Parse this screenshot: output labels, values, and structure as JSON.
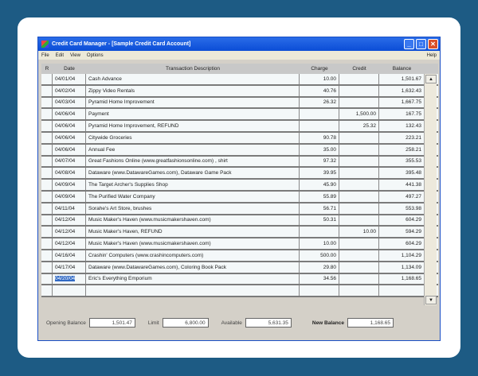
{
  "window": {
    "title": "Credit Card Manager - [Sample Credit Card Account]"
  },
  "menu": {
    "file": "File",
    "edit": "Edit",
    "view": "View",
    "options": "Options",
    "help": "Help"
  },
  "columns": {
    "r": "R",
    "date": "Date",
    "desc": "Transaction Description",
    "charge": "Charge",
    "credit": "Credit",
    "balance": "Balance"
  },
  "rows": [
    {
      "date": "04/01/04",
      "desc": "Cash Advance",
      "charge": "10.00",
      "credit": "",
      "balance": "1,501.67"
    },
    {
      "date": "04/02/04",
      "desc": "Zippy Video Rentals",
      "charge": "40.76",
      "credit": "",
      "balance": "1,632.43"
    },
    {
      "date": "04/03/04",
      "desc": "Pyramid Home Improvement",
      "charge": "26.32",
      "credit": "",
      "balance": "1,667.75"
    },
    {
      "date": "04/06/04",
      "desc": "Payment",
      "charge": "",
      "credit": "1,500.00",
      "balance": "167.75"
    },
    {
      "date": "04/06/04",
      "desc": "Pyramid Home Improvement, REFUND",
      "charge": "",
      "credit": "25.32",
      "balance": "132.43"
    },
    {
      "date": "04/06/04",
      "desc": "Citywide Groceries",
      "charge": "90.78",
      "credit": "",
      "balance": "223.21"
    },
    {
      "date": "04/06/04",
      "desc": "Annual Fee",
      "charge": "35.00",
      "credit": "",
      "balance": "258.21"
    },
    {
      "date": "04/07/04",
      "desc": "Great Fashions Online (www.greatfashionsonline.com) , shirt",
      "charge": "97.32",
      "credit": "",
      "balance": "355.53"
    },
    {
      "date": "04/08/04",
      "desc": "Dataware (www.DatawareGames.com), Dataware Game Pack",
      "charge": "39.95",
      "credit": "",
      "balance": "395.48"
    },
    {
      "date": "04/09/04",
      "desc": "The Target Archer's Supplies Shop",
      "charge": "45.90",
      "credit": "",
      "balance": "441.38"
    },
    {
      "date": "04/09/04",
      "desc": "The Purified Water Company",
      "charge": "55.89",
      "credit": "",
      "balance": "497.27"
    },
    {
      "date": "04/11/04",
      "desc": "Sorahe's Art Store, brushes",
      "charge": "56.71",
      "credit": "",
      "balance": "553.98"
    },
    {
      "date": "04/12/04",
      "desc": "Music Maker's Haven (www.musicmakershaven.com)",
      "charge": "50.31",
      "credit": "",
      "balance": "604.29"
    },
    {
      "date": "04/12/04",
      "desc": "Music Maker's Haven, REFUND",
      "charge": "",
      "credit": "10.00",
      "balance": "594.29"
    },
    {
      "date": "04/12/04",
      "desc": "Music Maker's Haven (www.musicmakershaven.com)",
      "charge": "10.00",
      "credit": "",
      "balance": "604.29"
    },
    {
      "date": "04/16/04",
      "desc": "Crashin' Computers (www.crashincomputers.com)",
      "charge": "500.00",
      "credit": "",
      "balance": "1,104.29"
    },
    {
      "date": "04/17/04",
      "desc": "Dataware (www.DatawareGames.com), Coloring Book Pack",
      "charge": "29.80",
      "credit": "",
      "balance": "1,134.09"
    },
    {
      "date": "04/20/04",
      "desc": "Eric's Everything Emporium",
      "charge": "34.56",
      "credit": "",
      "balance": "1,168.65"
    }
  ],
  "footer": {
    "opening_label": "Opening Balance",
    "opening": "1,501.47",
    "limit_label": "Limit",
    "limit": "6,800.00",
    "available_label": "Available",
    "available": "5,631.35",
    "new_label": "New Balance",
    "new": "1,168.65"
  }
}
